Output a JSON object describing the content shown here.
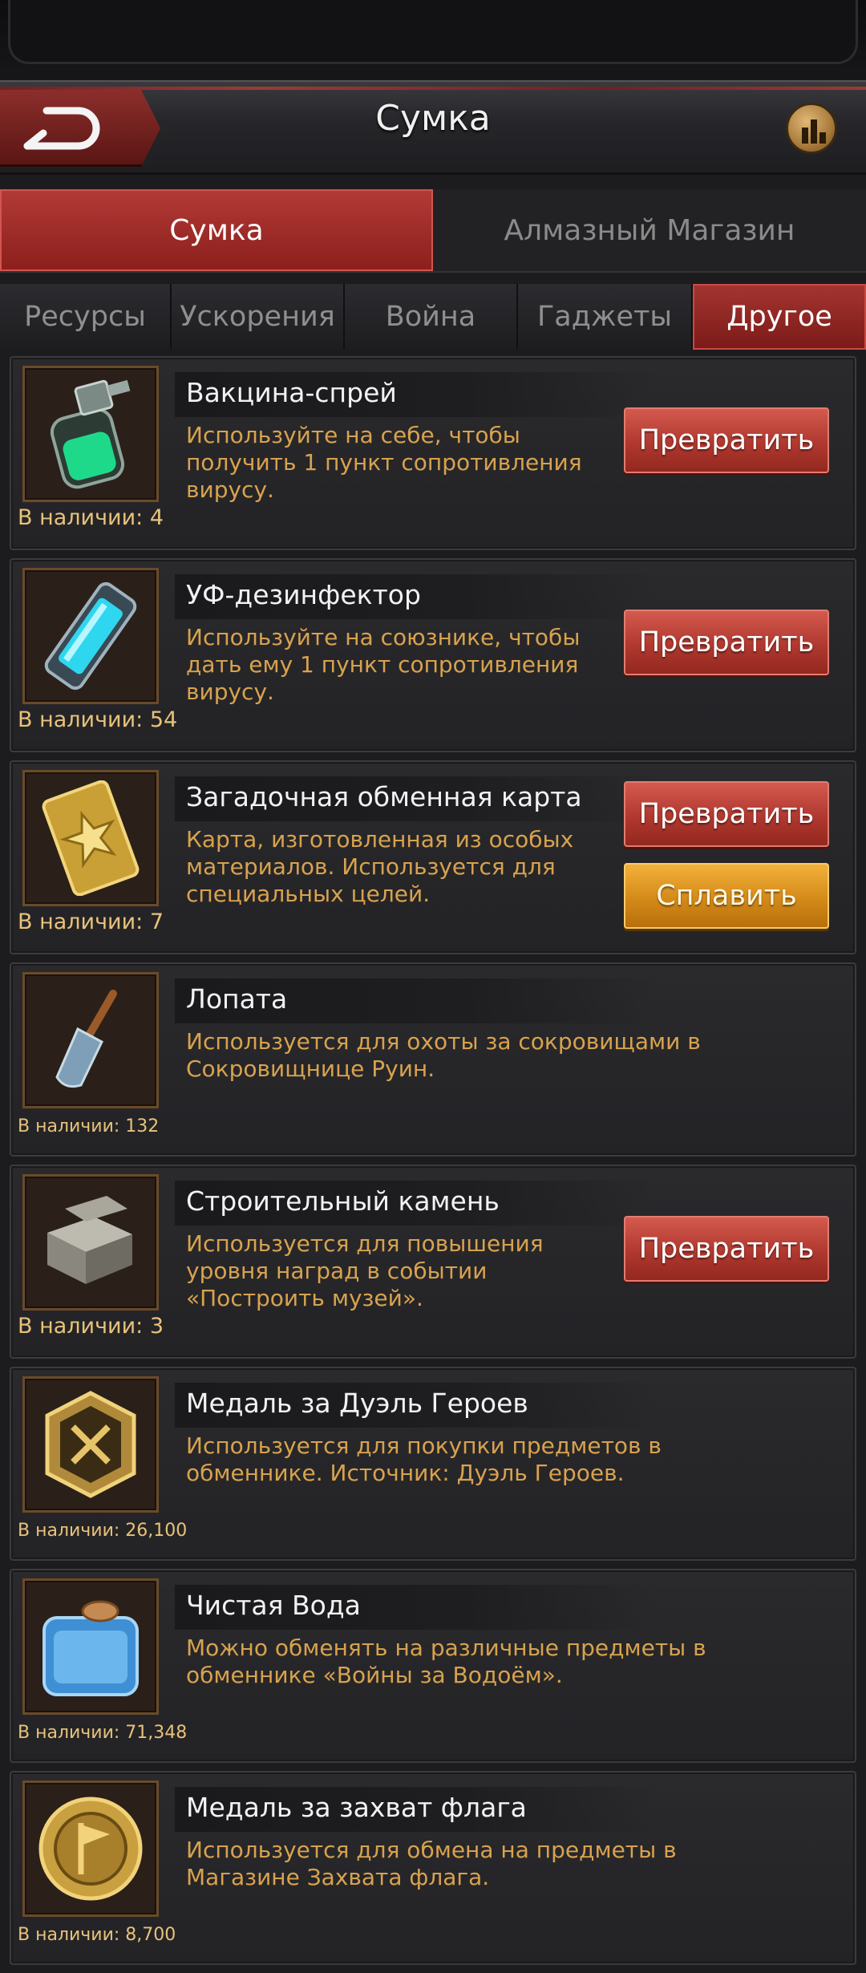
{
  "header": {
    "title": "Сумка"
  },
  "main_tabs": [
    {
      "label": "Сумка",
      "active": true
    },
    {
      "label": "Алмазный Магазин",
      "active": false
    }
  ],
  "sub_tabs": [
    {
      "label": "Ресурсы",
      "active": false
    },
    {
      "label": "Ускорения",
      "active": false
    },
    {
      "label": "Война",
      "active": false
    },
    {
      "label": "Гаджеты",
      "active": false
    },
    {
      "label": "Другое",
      "active": true
    }
  ],
  "items": [
    {
      "name": "Вакцина-спрей",
      "description": "Используйте на себе, чтобы получить 1 пункт сопротивления вирусу.",
      "stock": "В наличии: 4",
      "icon": "vaccine-spray-icon",
      "buttons": [
        "Превратить"
      ]
    },
    {
      "name": "УФ-дезинфектор",
      "description": "Используйте на союзнике, чтобы дать ему 1 пункт сопротивления вирусу.",
      "stock": "В наличии: 54",
      "icon": "uv-disinfector-icon",
      "buttons": [
        "Превратить"
      ]
    },
    {
      "name": "Загадочная обменная карта",
      "description": "Карта, изготовленная из особых материалов. Используется для специальных целей.",
      "stock": "В наличии: 7",
      "icon": "exchange-card-icon",
      "buttons": [
        "Превратить",
        "Сплавить"
      ]
    },
    {
      "name": "Лопата",
      "description": "Используется для охоты за сокровищами в Сокровищнице Руин.",
      "stock": "В наличии: 132",
      "icon": "shovel-icon",
      "buttons": []
    },
    {
      "name": "Строительный камень",
      "description": "Используется для повышения уровня наград в событии «Построить музей».",
      "stock": "В наличии: 3",
      "icon": "building-stone-icon",
      "buttons": [
        "Превратить"
      ]
    },
    {
      "name": "Медаль за Дуэль Героев",
      "description": "Используется для покупки предметов в обменнике. Источник: Дуэль Героев.",
      "stock": "В наличии: 26,100",
      "icon": "hero-duel-medal-icon",
      "buttons": []
    },
    {
      "name": "Чистая Вода",
      "description": "Можно обменять на различные предметы в обменнике «Войны за Водоём».",
      "stock": "В наличии: 71,348",
      "icon": "clean-water-icon",
      "buttons": []
    },
    {
      "name": "Медаль за захват флага",
      "description": "Используется для обмена на предметы в Магазине Захвата флага.",
      "stock": "В наличии: 8,700",
      "icon": "capture-flag-medal-icon",
      "buttons": []
    }
  ]
}
